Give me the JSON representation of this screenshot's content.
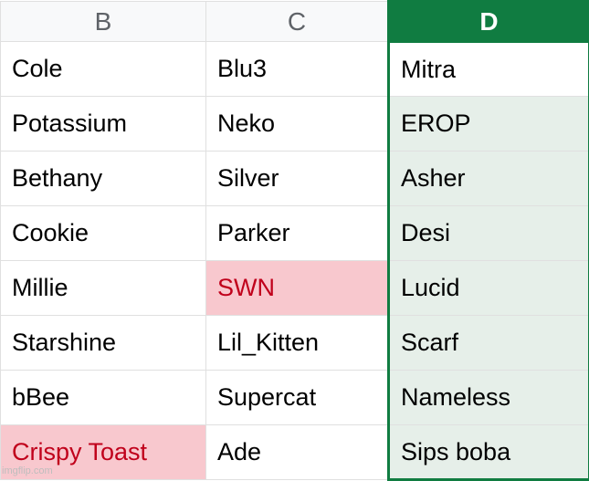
{
  "columns": {
    "B": {
      "label": "B",
      "selected": false
    },
    "C": {
      "label": "C",
      "selected": false
    },
    "D": {
      "label": "D",
      "selected": true
    }
  },
  "rows": [
    {
      "B": {
        "v": "Cole"
      },
      "C": {
        "v": "Blu3"
      },
      "D": {
        "v": "Mitra"
      }
    },
    {
      "B": {
        "v": "Potassium"
      },
      "C": {
        "v": "Neko"
      },
      "D": {
        "v": "EROP"
      }
    },
    {
      "B": {
        "v": "Bethany"
      },
      "C": {
        "v": "Silver"
      },
      "D": {
        "v": "Asher"
      }
    },
    {
      "B": {
        "v": "Cookie"
      },
      "C": {
        "v": "Parker"
      },
      "D": {
        "v": "Desi"
      }
    },
    {
      "B": {
        "v": "Millie"
      },
      "C": {
        "v": "SWN",
        "hl": true
      },
      "D": {
        "v": "Lucid"
      }
    },
    {
      "B": {
        "v": "Starshine"
      },
      "C": {
        "v": "Lil_Kitten"
      },
      "D": {
        "v": "Scarf"
      }
    },
    {
      "B": {
        "v": "bBee"
      },
      "C": {
        "v": "Supercat"
      },
      "D": {
        "v": "Nameless"
      }
    },
    {
      "B": {
        "v": "Crispy Toast",
        "hl": true
      },
      "C": {
        "v": "Ade"
      },
      "D": {
        "v": "Sips boba"
      }
    }
  ],
  "watermark": "imgflip.com",
  "colors": {
    "selection": "#107c41",
    "selectionFill": "#e6efe9",
    "highlightFill": "#f8c8ce",
    "highlightText": "#c0001b"
  }
}
